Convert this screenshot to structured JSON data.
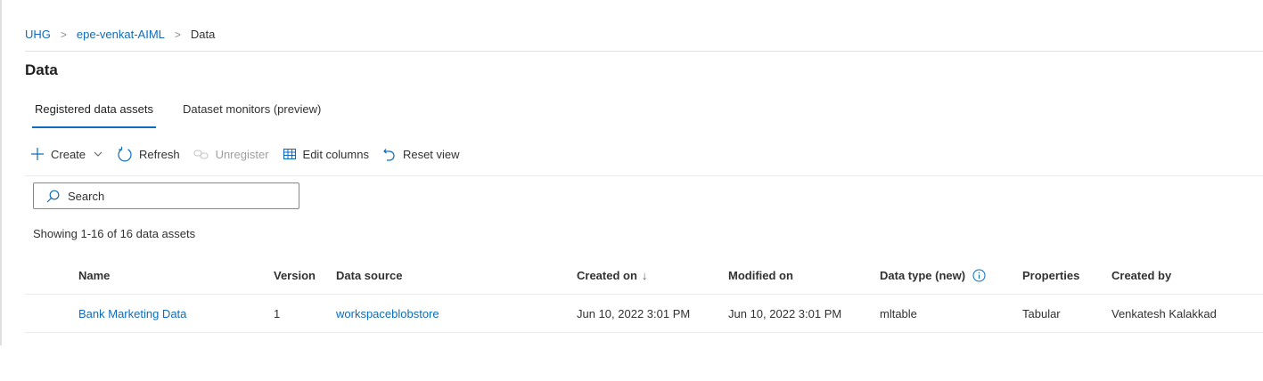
{
  "breadcrumb": {
    "items": [
      "UHG",
      "epe-venkat-AIML"
    ],
    "current": "Data",
    "separator": ">"
  },
  "page": {
    "title": "Data"
  },
  "tabs": [
    {
      "label": "Registered data assets",
      "active": true
    },
    {
      "label": "Dataset monitors (preview)",
      "active": false
    }
  ],
  "toolbar": {
    "create": "Create",
    "refresh": "Refresh",
    "unregister": "Unregister",
    "edit_columns": "Edit columns",
    "reset_view": "Reset view"
  },
  "search": {
    "placeholder": "Search",
    "value": ""
  },
  "summary": "Showing 1-16 of 16 data assets",
  "table": {
    "columns": [
      "Name",
      "Version",
      "Data source",
      "Created on",
      "Modified on",
      "Data type (new)",
      "Properties",
      "Created by"
    ],
    "sort": {
      "column": "Created on",
      "direction": "descending",
      "arrow": "↓"
    },
    "rows": [
      {
        "name": "Bank Marketing Data",
        "version": "1",
        "data_source": "workspaceblobstore",
        "created_on": "Jun 10, 2022 3:01 PM",
        "modified_on": "Jun 10, 2022 3:01 PM",
        "data_type": "mltable",
        "properties": "Tabular",
        "created_by": "Venkatesh Kalakkad"
      }
    ]
  },
  "colors": {
    "link": "#0f6cbd",
    "text": "#323130",
    "disabled": "#a19f9d",
    "border": "#edebe9"
  }
}
